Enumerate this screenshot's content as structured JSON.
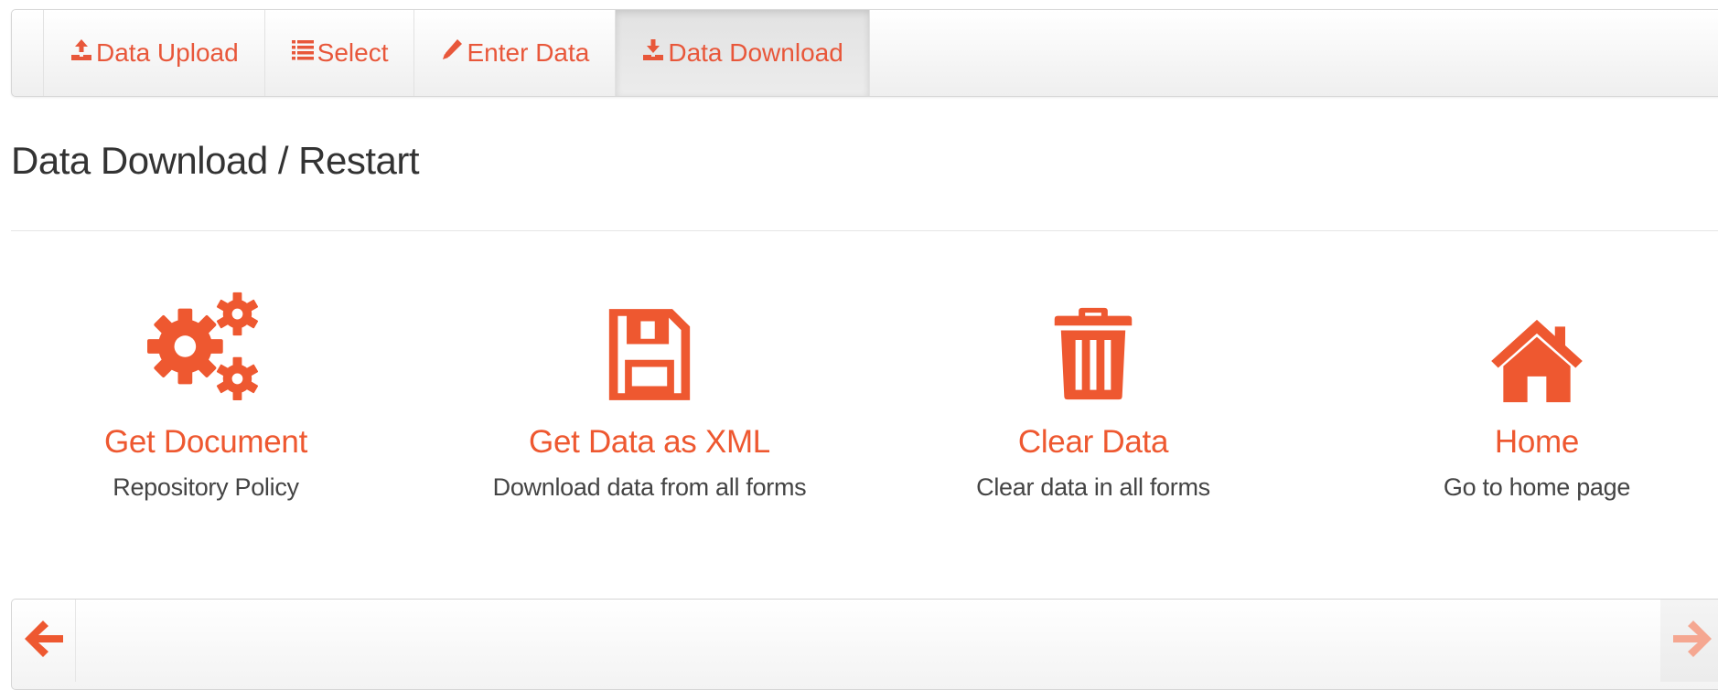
{
  "nav": {
    "tabs": [
      {
        "label": "Data Upload",
        "icon": "upload-icon",
        "active": false
      },
      {
        "label": "Select",
        "icon": "list-icon",
        "active": false
      },
      {
        "label": "Enter Data",
        "icon": "pencil-icon",
        "active": false
      },
      {
        "label": "Data Download",
        "icon": "download-icon",
        "active": true
      }
    ]
  },
  "page": {
    "title": "Data Download / Restart"
  },
  "actions": [
    {
      "title": "Get Document",
      "description": "Repository Policy",
      "icon": "gears-icon"
    },
    {
      "title": "Get Data as XML",
      "description": "Download data from all forms",
      "icon": "floppy-disk-icon"
    },
    {
      "title": "Clear Data",
      "description": "Clear data in all forms",
      "icon": "trash-icon"
    },
    {
      "title": "Home",
      "description": "Go to home page",
      "icon": "home-icon"
    }
  ],
  "pager": {
    "prev_icon": "arrow-left-icon",
    "next_icon": "arrow-right-icon"
  },
  "colors": {
    "accent": "#ee5830",
    "nav_text": "#e8573a",
    "next_arrow_disabled": "#f5a791"
  }
}
